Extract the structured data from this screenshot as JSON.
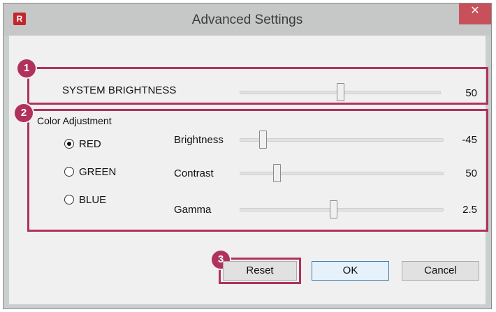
{
  "window": {
    "title": "Advanced Settings",
    "app_icon": "R",
    "close_glyph": "✕"
  },
  "system": {
    "label": "SYSTEM BRIGHTNESS",
    "value": "50",
    "slider_fraction": 0.5
  },
  "color": {
    "group_label": "Color Adjustment",
    "radios": [
      {
        "label": "RED",
        "checked": true
      },
      {
        "label": "GREEN",
        "checked": false
      },
      {
        "label": "BLUE",
        "checked": false
      }
    ],
    "sliders": [
      {
        "label": "Brightness",
        "value": "-45",
        "slider_fraction": 0.1
      },
      {
        "label": "Contrast",
        "value": "50",
        "slider_fraction": 0.17
      },
      {
        "label": "Gamma",
        "value": "2.5",
        "slider_fraction": 0.46
      }
    ]
  },
  "buttons": {
    "reset": "Reset",
    "ok": "OK",
    "cancel": "Cancel"
  },
  "badges": [
    "1",
    "2",
    "3"
  ],
  "colors": {
    "highlight": "#b0325c",
    "close": "#c7505a",
    "accent": "#3c7fb1"
  }
}
